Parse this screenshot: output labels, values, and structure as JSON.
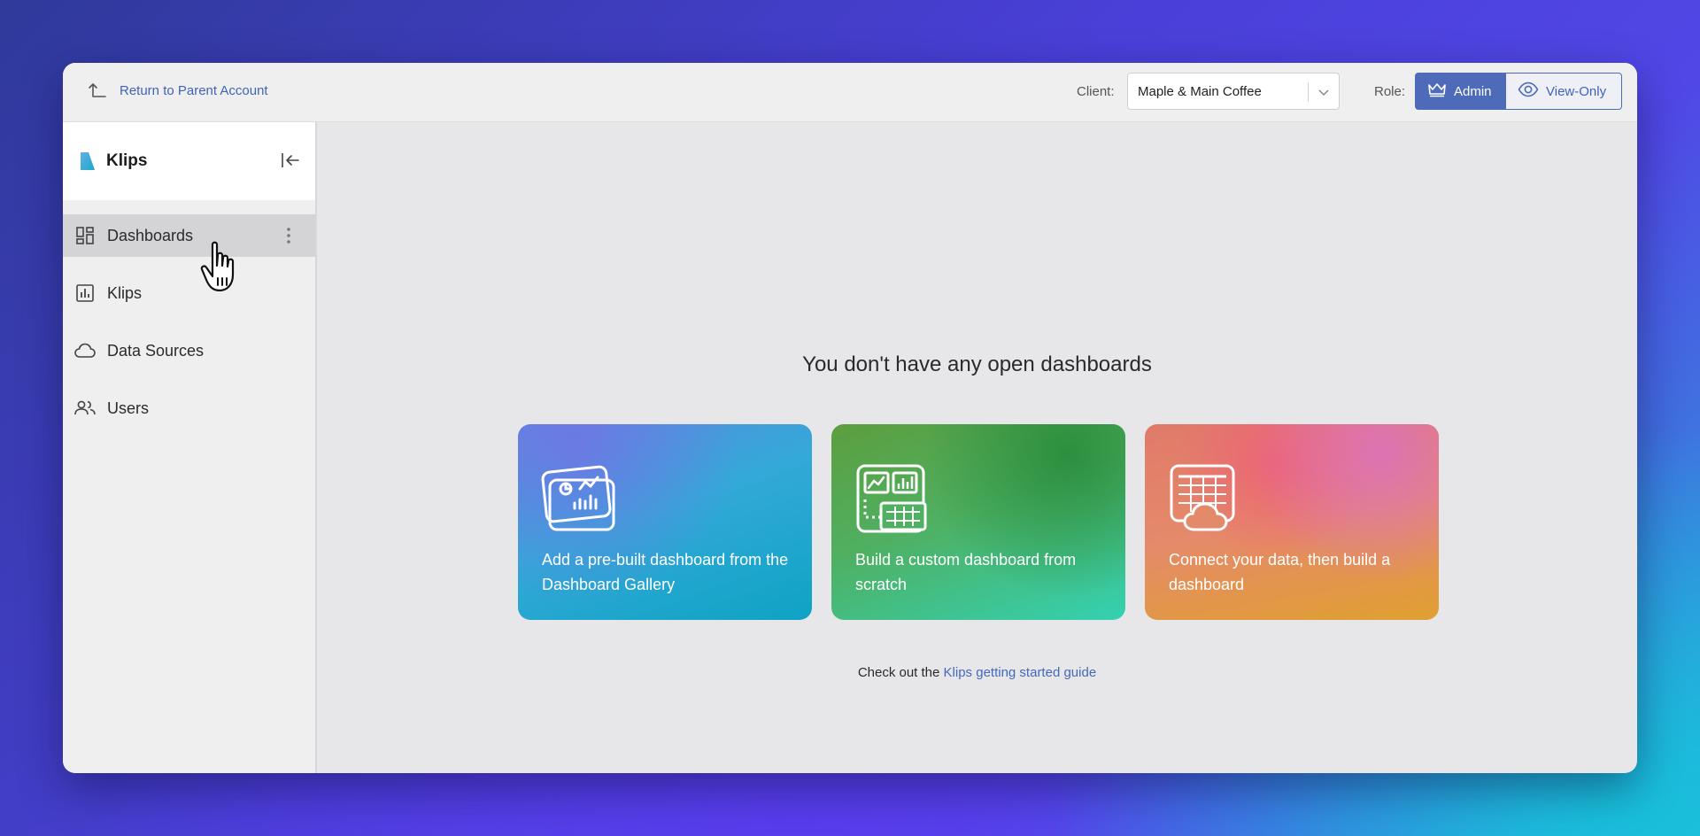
{
  "topbar": {
    "return_label": "Return to Parent Account",
    "client_label": "Client:",
    "client_value": "Maple & Main Coffee",
    "role_label": "Role:",
    "role_admin": "Admin",
    "role_view_only": "View-Only",
    "active_role": "Admin"
  },
  "sidebar": {
    "brand": "Klips",
    "items": [
      {
        "label": "Dashboards",
        "icon": "dashboard-grid-icon",
        "active": true
      },
      {
        "label": "Klips",
        "icon": "bar-chart-icon",
        "active": false
      },
      {
        "label": "Data Sources",
        "icon": "cloud-icon",
        "active": false
      },
      {
        "label": "Users",
        "icon": "users-icon",
        "active": false
      }
    ]
  },
  "main": {
    "empty_title": "You don't have any open dashboards",
    "cards": [
      {
        "text": "Add a pre-built dashboard from the Dashboard Gallery",
        "icon": "dashboard-gallery-icon"
      },
      {
        "text": "Build a custom dashboard from scratch",
        "icon": "custom-dashboard-icon"
      },
      {
        "text": "Connect your data, then build a dashboard",
        "icon": "data-cloud-icon"
      }
    ],
    "guide_prefix": "Check out the",
    "guide_link": "Klips getting started guide"
  },
  "colors": {
    "accent": "#4d6bb8",
    "link": "#3f64b8",
    "sidebar_active": "#d4d4d7"
  }
}
